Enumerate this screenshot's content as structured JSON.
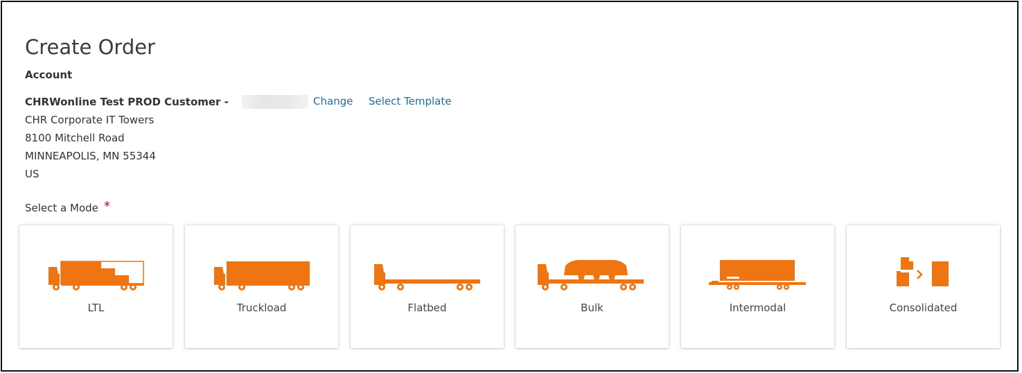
{
  "page": {
    "title": "Create Order"
  },
  "account": {
    "label": "Account",
    "name": "CHRWonline Test PROD Customer -",
    "address_lines": [
      "CHR Corporate IT Towers",
      "8100 Mitchell Road",
      "MINNEAPOLIS, MN 55344",
      "US"
    ],
    "change_link": "Change",
    "template_link": "Select Template"
  },
  "mode_select": {
    "label": "Select a Mode",
    "required_marker": "*",
    "options": [
      {
        "label": "LTL",
        "icon": "ltl-truck-icon"
      },
      {
        "label": "Truckload",
        "icon": "truckload-icon"
      },
      {
        "label": "Flatbed",
        "icon": "flatbed-icon"
      },
      {
        "label": "Bulk",
        "icon": "bulk-icon"
      },
      {
        "label": "Intermodal",
        "icon": "intermodal-icon"
      },
      {
        "label": "Consolidated",
        "icon": "consolidated-icon"
      }
    ]
  },
  "colors": {
    "icon_accent": "#ef7512",
    "link": "#1a6fa3",
    "required": "#d0021b"
  }
}
